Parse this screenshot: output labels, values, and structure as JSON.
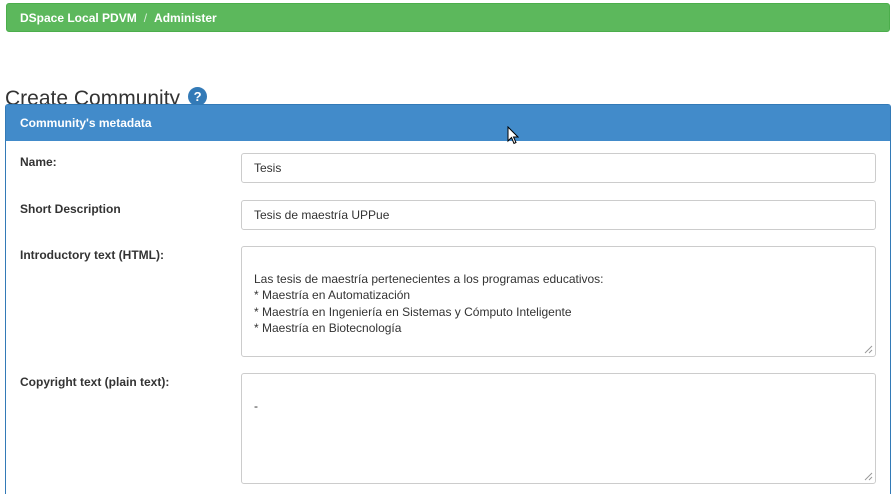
{
  "breadcrumb": {
    "items": [
      "DSpace Local PDVM",
      "Administer"
    ],
    "separator": "/"
  },
  "page": {
    "title": "Create Community",
    "help_icon": "question-circle-icon",
    "help_symbol": "?"
  },
  "panel": {
    "heading": "Community's metadata"
  },
  "form": {
    "name": {
      "label": "Name:",
      "value": "Tesis"
    },
    "short_description": {
      "label": "Short Description",
      "value": "Tesis de maestría UPPue"
    },
    "introductory_text": {
      "label": "Introductory text (HTML):",
      "value": "Las tesis de maestría pertenecientes a los programas educativos:\n* Maestría en Automatización\n* Maestría en Ingeniería en Sistemas y Cómputo Inteligente\n* Maestría en Biotecnología"
    },
    "copyright_text": {
      "label": "Copyright text (plain text):",
      "value": "-"
    }
  },
  "colors": {
    "breadcrumb_bg": "#5cb85c",
    "panel_heading_bg": "#428bca",
    "help_icon_bg": "#337ab7"
  }
}
